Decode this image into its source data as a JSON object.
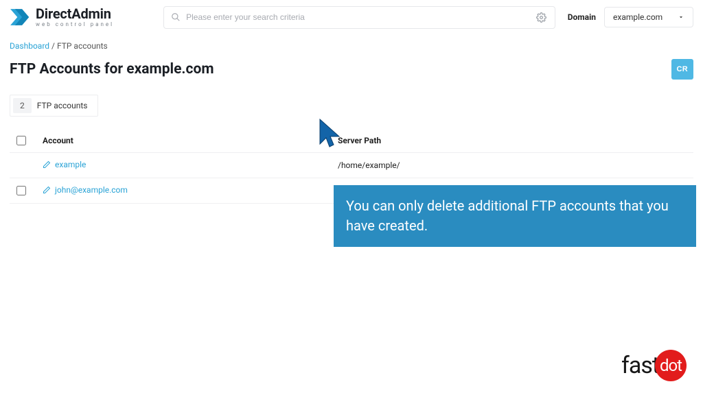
{
  "header": {
    "logo_main": "DirectAdmin",
    "logo_sub": "web control panel",
    "search_placeholder": "Please enter your search criteria",
    "domain_label": "Domain",
    "domain_value": "example.com"
  },
  "breadcrumb": {
    "root": "Dashboard",
    "current": "FTP accounts"
  },
  "page": {
    "title": "FTP Accounts for example.com",
    "create_button": "CR",
    "count": "2",
    "count_label": "FTP accounts"
  },
  "table": {
    "columns": {
      "account": "Account",
      "path": "Server Path"
    },
    "rows": [
      {
        "account": "example",
        "path": "/home/example/"
      },
      {
        "account": "john@example.com",
        "path": ""
      }
    ]
  },
  "callout": "You can only delete additional FTP accounts that you have created.",
  "footer": {
    "brand_left": "fast",
    "brand_right": "dot"
  }
}
